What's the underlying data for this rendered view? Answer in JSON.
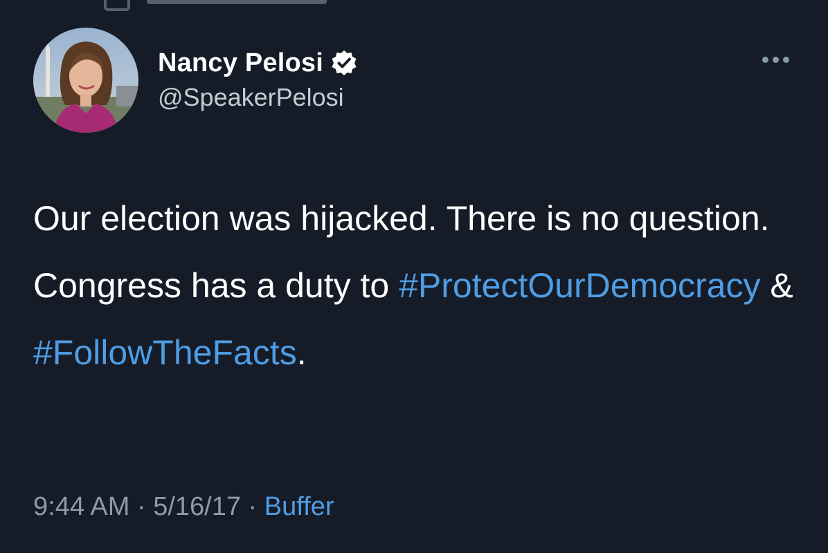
{
  "tweet": {
    "display_name": "Nancy Pelosi",
    "handle": "@SpeakerPelosi",
    "text_part1": "Our election was hijacked. There is no question. Congress has a duty to ",
    "hashtag1": "#ProtectOurDemocracy",
    "text_part2": " & ",
    "hashtag2": "#FollowTheFacts",
    "text_part3": ".",
    "time": "9:44 AM",
    "date": "5/16/17",
    "source": "Buffer",
    "separator": " · "
  },
  "icons": {
    "verified": "verified-badge-icon",
    "more": "more-options-icon"
  },
  "colors": {
    "background": "#161c27",
    "text": "#ffffff",
    "secondary_text": "#8d9aa7",
    "link": "#4e9de5"
  }
}
